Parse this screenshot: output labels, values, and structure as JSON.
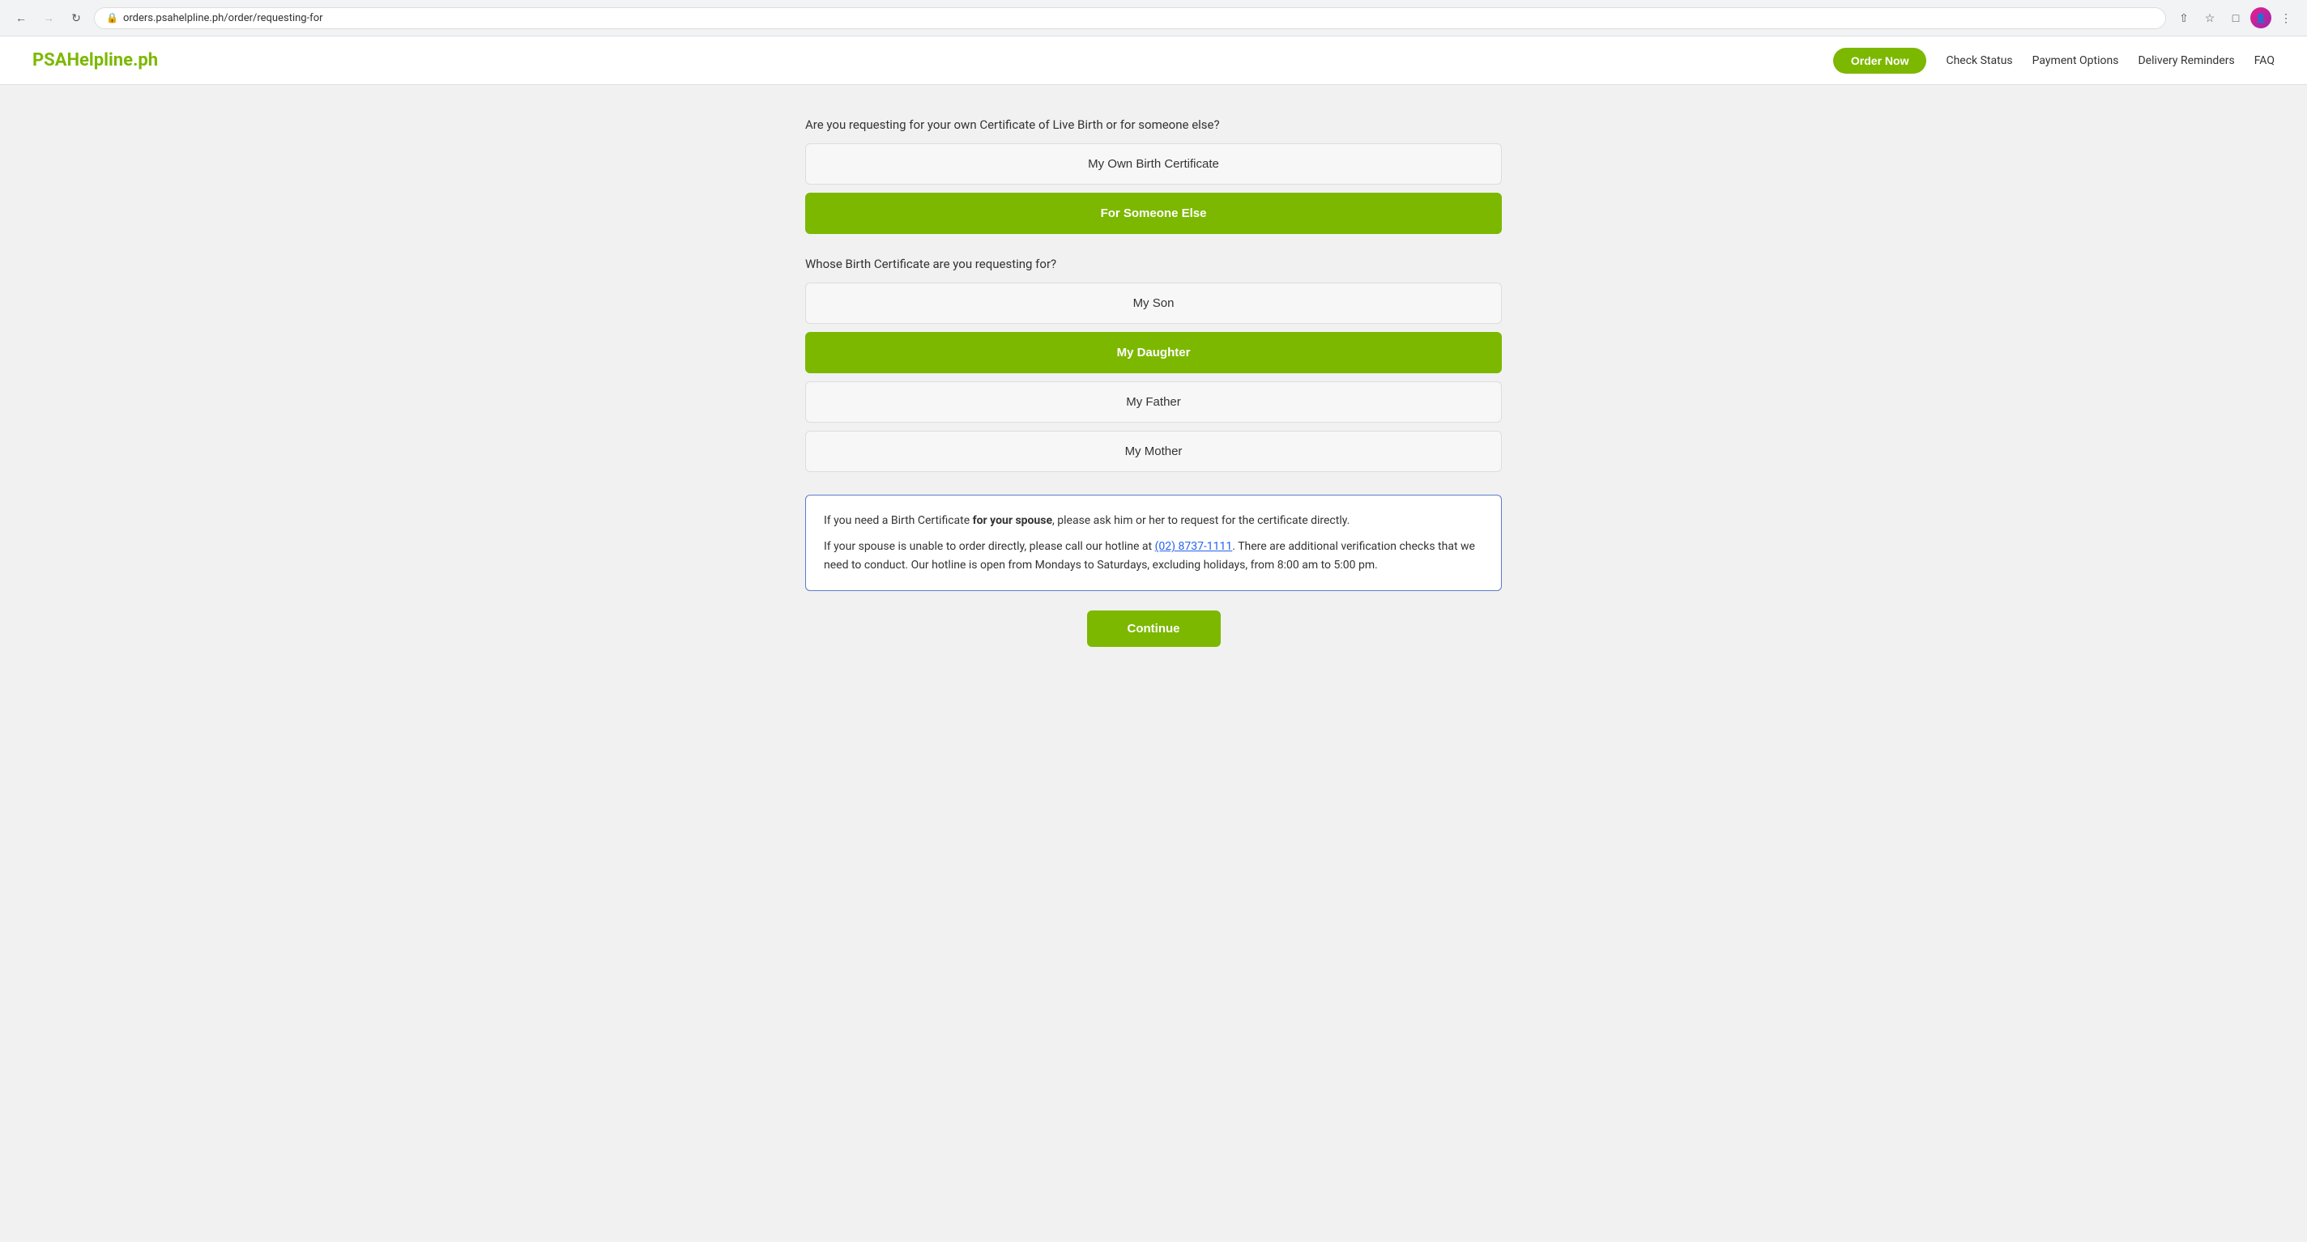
{
  "browser": {
    "url": "orders.psahelpline.ph/order/requesting-for",
    "back_disabled": false,
    "forward_disabled": true
  },
  "header": {
    "logo": "PSAHelpline.ph",
    "nav": {
      "order_now": "Order Now",
      "check_status": "Check Status",
      "payment_options": "Payment Options",
      "delivery_reminders": "Delivery Reminders",
      "faq": "FAQ"
    }
  },
  "main": {
    "question1": {
      "label": "Are you requesting for your own Certificate of Live Birth or for someone else?",
      "options": [
        {
          "id": "own",
          "label": "My Own Birth Certificate",
          "active": false
        },
        {
          "id": "someone_else",
          "label": "For Someone Else",
          "active": true
        }
      ]
    },
    "question2": {
      "label": "Whose Birth Certificate are you requesting for?",
      "options": [
        {
          "id": "son",
          "label": "My Son",
          "active": false
        },
        {
          "id": "daughter",
          "label": "My Daughter",
          "active": true
        },
        {
          "id": "father",
          "label": "My Father",
          "active": false
        },
        {
          "id": "mother",
          "label": "My Mother",
          "active": false
        }
      ]
    },
    "info_box": {
      "line1_plain": "If you need a Birth Certificate ",
      "line1_bold": "for your spouse",
      "line1_rest": ", please ask him or her to request for the certificate directly.",
      "line2_prefix": "If your spouse is unable to order directly, please call our hotline at ",
      "hotline_text": "(02) 8737-1111",
      "hotline_href": "tel:028737-1111",
      "line2_rest": ". There are additional verification checks that we need to conduct. Our hotline is open from Mondays to Saturdays, excluding holidays, from 8:00 am to 5:00 pm."
    },
    "continue_button": "Continue"
  }
}
